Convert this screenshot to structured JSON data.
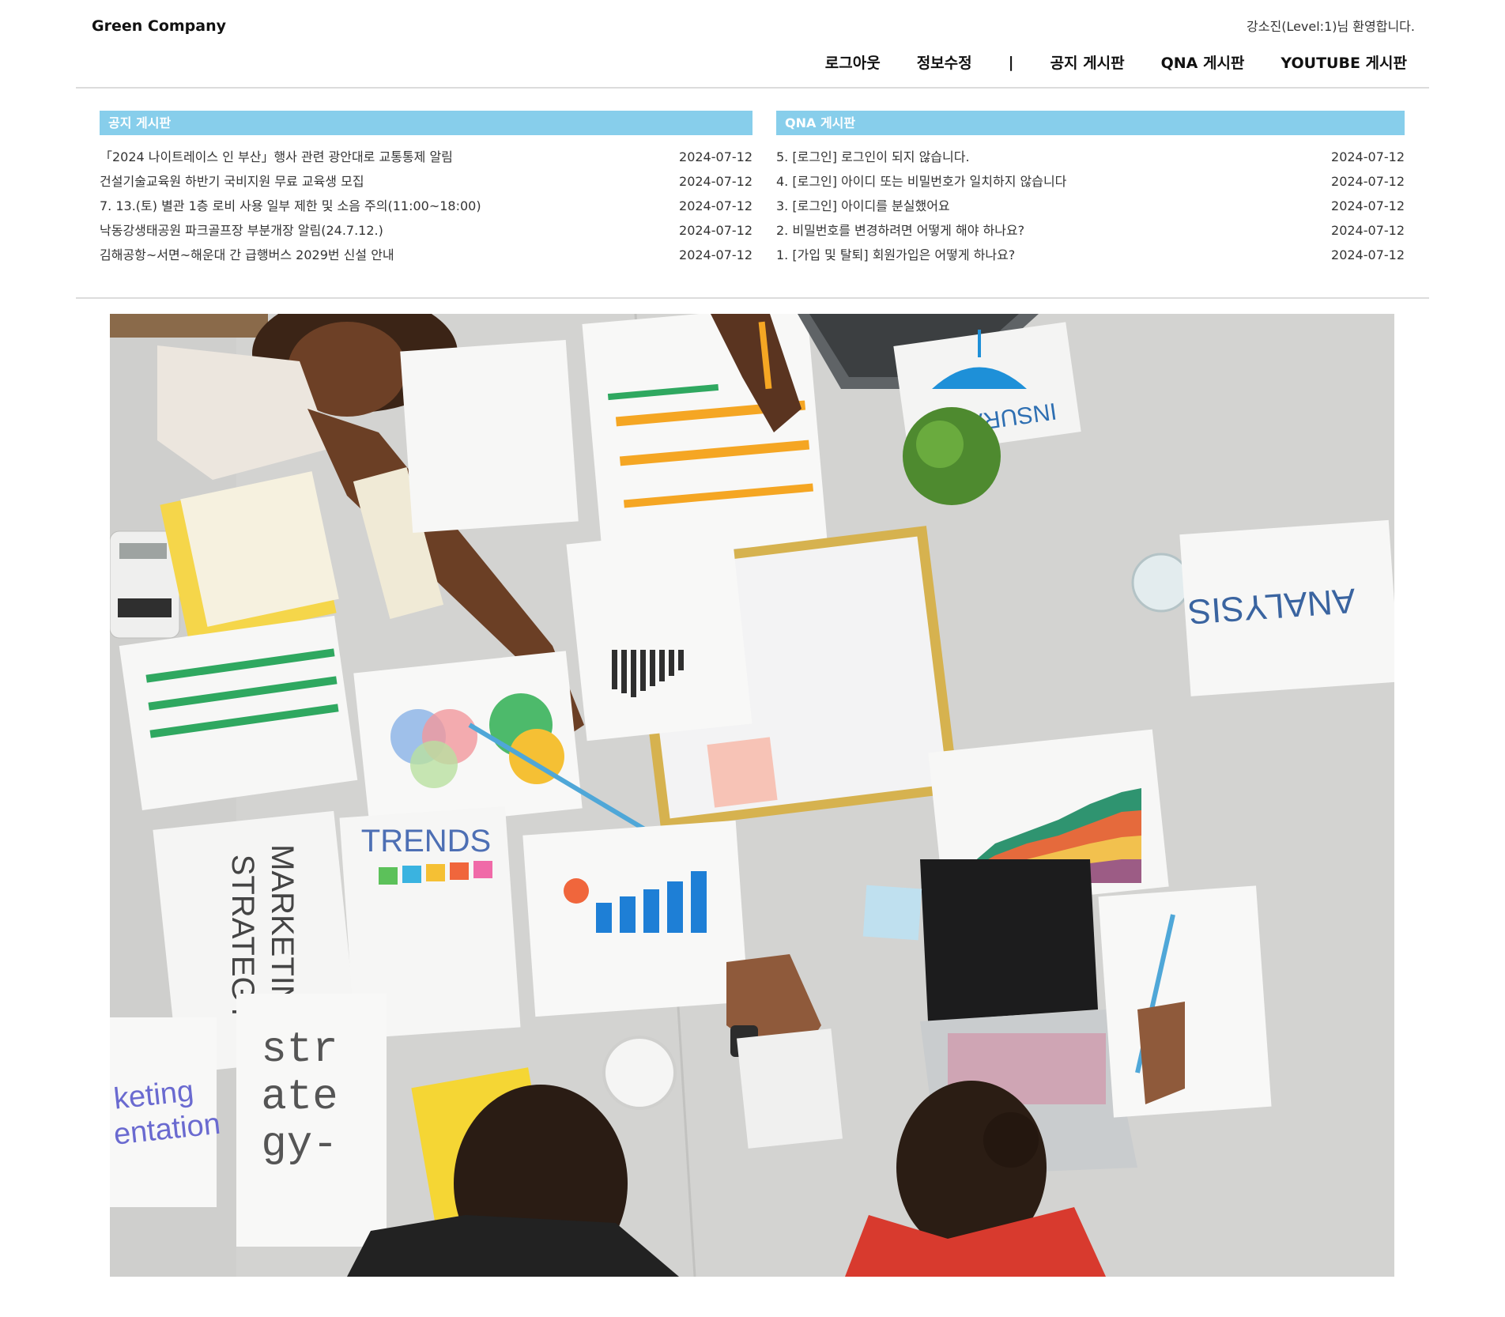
{
  "header": {
    "logo": "Green Company",
    "welcome": "강소진(Level:1)님 환영합니다.",
    "nav": {
      "logout": "로그아웃",
      "edit_info": "정보수정",
      "separator": "|",
      "notice_board": "공지 게시판",
      "qna_board": "QNA 게시판",
      "youtube_board": "YOUTUBE 게시판"
    }
  },
  "notice": {
    "title": "공지 게시판",
    "items": [
      {
        "title": "「2024 나이트레이스 인 부산」행사 관련 광안대로 교통통제 알림",
        "date": "2024-07-12"
      },
      {
        "title": "건설기술교육원 하반기 국비지원 무료 교육생 모집",
        "date": "2024-07-12"
      },
      {
        "title": "7. 13.(토) 별관 1층 로비 사용 일부 제한 및 소음 주의(11:00~18:00)",
        "date": "2024-07-12"
      },
      {
        "title": "낙동강생태공원 파크골프장 부분개장 알림(24.7.12.)",
        "date": "2024-07-12"
      },
      {
        "title": "김해공항~서면~해운대 간 급행버스 2029번 신설 안내",
        "date": "2024-07-12"
      }
    ]
  },
  "qna": {
    "title": "QNA 게시판",
    "items": [
      {
        "title": "5. [로그인] 로그인이 되지 않습니다.",
        "date": "2024-07-12"
      },
      {
        "title": "4. [로그인] 아이디 또는 비밀번호가 일치하지 않습니다",
        "date": "2024-07-12"
      },
      {
        "title": "3. [로그인] 아이디를 분실했어요",
        "date": "2024-07-12"
      },
      {
        "title": "2. 비밀번호를 변경하려면 어떻게 해야 하나요?",
        "date": "2024-07-12"
      },
      {
        "title": "1. [가입 및 탈퇴] 회원가입은 어떻게 하나요?",
        "date": "2024-07-12"
      }
    ]
  },
  "hero": {
    "texts": {
      "insurance": "INSURANCE",
      "analysis": "ANALYSIS",
      "marketing": "MARKETING",
      "strategy": "STRATEGY",
      "trends": "TRENDS",
      "str_1": "str",
      "str_2": "ate",
      "str_3": "gy-",
      "keting": "keting",
      "entation": "entation"
    }
  }
}
